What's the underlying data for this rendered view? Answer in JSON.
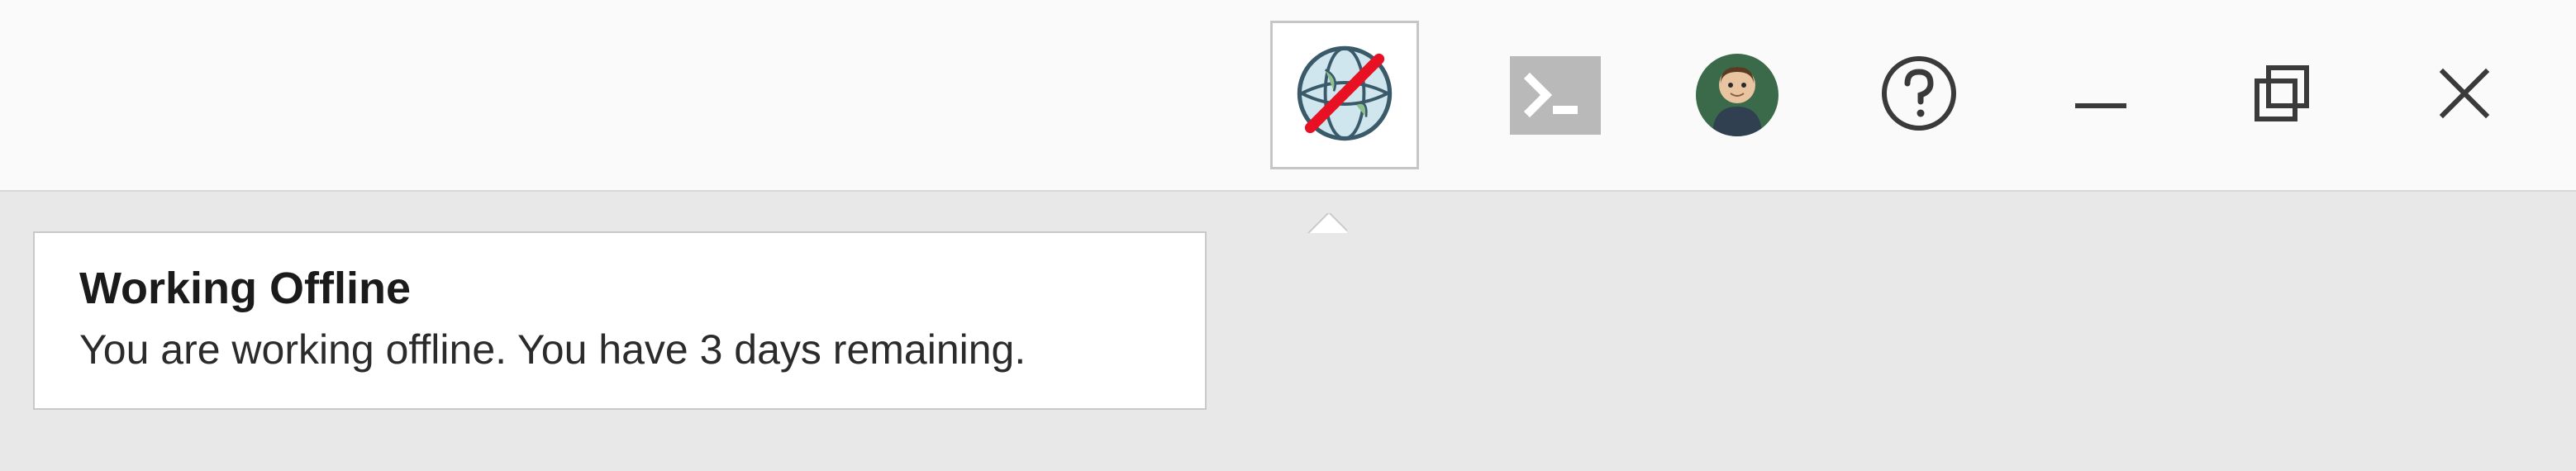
{
  "toolbar": {
    "offline_icon": "globe-offline-icon",
    "terminal_icon": "terminal-icon",
    "avatar_icon": "user-avatar",
    "help_icon": "help-icon",
    "minimize_icon": "minimize-icon",
    "restore_icon": "restore-icon",
    "close_icon": "close-icon"
  },
  "tooltip": {
    "title": "Working Offline",
    "body": "You are working offline. You have 3 days remaining."
  }
}
